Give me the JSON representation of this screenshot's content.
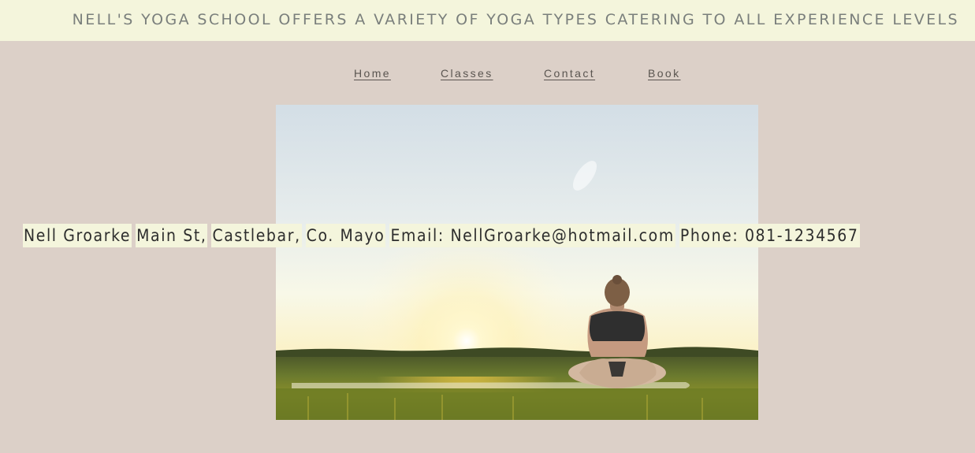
{
  "banner": {
    "text": "NELL'S YOGA SCHOOL OFFERS A VARIETY OF YOGA TYPES CATERING TO ALL EXPERIENCE LEVELS"
  },
  "nav": {
    "home": "Home",
    "classes": "Classes",
    "contact": "Contact",
    "book": "Book"
  },
  "hero": {
    "image": "yoga-sunset-meditation"
  },
  "contact_info": {
    "name": "Nell Groarke",
    "street": "Main St,",
    "town": "Castlebar,",
    "county": "Co. Mayo",
    "email": "Email: NellGroarke@hotmail.com",
    "phone": "Phone: 081-1234567"
  },
  "colors": {
    "page_bg": "#dcd0c8",
    "banner_bg": "#f4f5dc",
    "banner_text": "#7a7f7c",
    "contact_bg": "#f4f5dc"
  }
}
